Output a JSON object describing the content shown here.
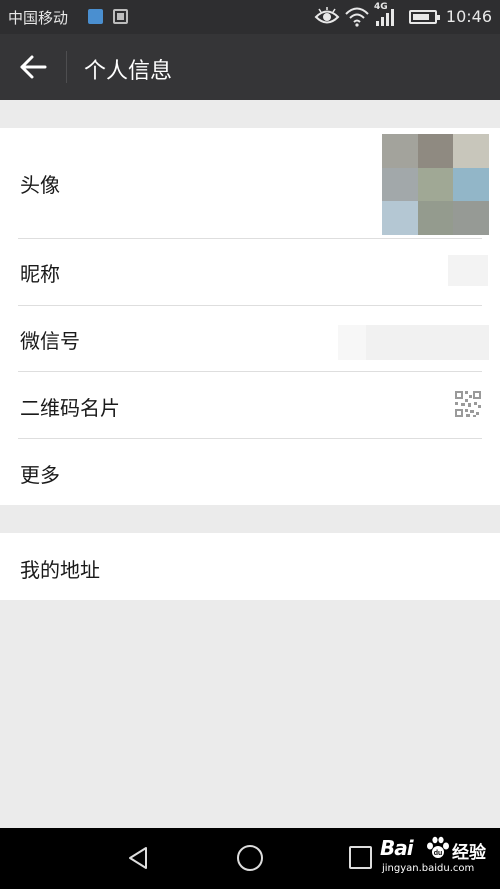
{
  "status_bar": {
    "carrier": "中国移动",
    "network": "4G",
    "time": "10:46"
  },
  "header": {
    "title": "个人信息"
  },
  "profile": {
    "items": [
      {
        "label": "头像"
      },
      {
        "label": "昵称"
      },
      {
        "label": "微信号"
      },
      {
        "label": "二维码名片"
      },
      {
        "label": "更多"
      }
    ],
    "avatar_colors": [
      "#a3a39c",
      "#8f8a81",
      "#c8c6bb",
      "#a2a8aa",
      "#a0a895",
      "#92b6c8",
      "#b4c7d3",
      "#949b8e",
      "#969a95"
    ]
  },
  "address": {
    "items": [
      {
        "label": "我的地址"
      }
    ]
  },
  "watermark": {
    "logo": "Bai",
    "text": "经验",
    "url": "jingyan.baidu.com"
  },
  "colors": {
    "status_bar_bg": "#2e2e30",
    "title_bar_bg": "#353537",
    "page_bg": "#ebebeb",
    "row_bg": "#ffffff",
    "nav_bar_bg": "#000000"
  }
}
